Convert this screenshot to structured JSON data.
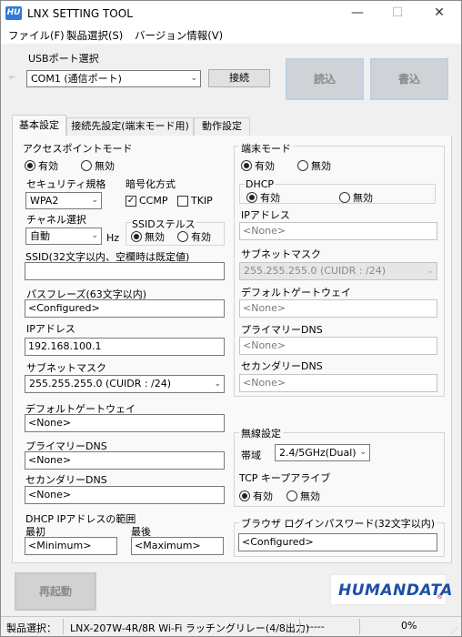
{
  "window": {
    "title": "LNX SETTING TOOL",
    "minimize": "—",
    "maximize": "☐",
    "close": "✕",
    "app_icon_text": "HU"
  },
  "menu": [
    "ファイル(F)",
    "製品選択(S)",
    "バージョン情報(V)"
  ],
  "usb": {
    "label": "USBポート選択",
    "port_value": "COM1 (通信ポート)",
    "connect_button": "接続"
  },
  "actions": {
    "read_button": "読込",
    "write_button": "書込",
    "restart_button": "再起動"
  },
  "tabs": [
    "基本設定",
    "接続先設定(端末モード用)",
    "動作設定"
  ],
  "access_point": {
    "group_label": "アクセスポイントモード",
    "enable": "有効",
    "disable": "無効",
    "selected": "enable",
    "security_label": "セキュリティ規格",
    "security_value": "WPA2",
    "encryption_label": "暗号化方式",
    "ccmp_label": "CCMP",
    "ccmp_checked": true,
    "tkip_label": "TKIP",
    "tkip_checked": false,
    "channel_label": "チャネル選択",
    "channel_value": "自動",
    "channel_unit": "Hz",
    "stealth_label": "SSIDステルス",
    "stealth_disable": "無効",
    "stealth_enable": "有効",
    "stealth_selected": "disable",
    "ssid_label": "SSID(32文字以内、空欄時は既定値)",
    "ssid_value": "",
    "passphrase_label": "パスフレーズ(63文字以内)",
    "passphrase_value": "<Configured>",
    "ip_label": "IPアドレス",
    "ip_value": "192.168.100.1",
    "subnet_label": "サブネットマスク",
    "subnet_value": "255.255.255.0 (CUIDR : /24)",
    "gateway_label": "デフォルトゲートウェイ",
    "gateway_value": "<None>",
    "dns1_label": "プライマリーDNS",
    "dns1_value": "<None>",
    "dns2_label": "セカンダリーDNS",
    "dns2_value": "<None>",
    "dhcp_range_label": "DHCP IPアドレスの範囲",
    "range_first_label": "最初",
    "range_first_value": "<Minimum>",
    "range_last_label": "最後",
    "range_last_value": "<Maximum>"
  },
  "terminal": {
    "group_label": "端末モード",
    "enable": "有効",
    "disable": "無効",
    "selected": "enable",
    "dhcp_label": "DHCP",
    "dhcp_enable": "有効",
    "dhcp_disable": "無効",
    "dhcp_selected": "enable",
    "ip_label": "IPアドレス",
    "ip_value": "<None>",
    "subnet_label": "サブネットマスク",
    "subnet_value": "255.255.255.0 (CUIDR : /24)",
    "gateway_label": "デフォルトゲートウェイ",
    "gateway_value": "<None>",
    "dns1_label": "プライマリーDNS",
    "dns1_value": "<None>",
    "dns2_label": "セカンダリーDNS",
    "dns2_value": "<None>"
  },
  "wireless": {
    "group_label": "無線設定",
    "band_label": "帯域",
    "band_value": "2.4/5GHz(Dual)",
    "keepalive_label": "TCP キープアライブ",
    "keepalive_enable": "有効",
    "keepalive_disable": "無効",
    "keepalive_selected": "enable"
  },
  "browser": {
    "label": "ブラウザ ログインパスワード(32文字以内)",
    "value": "<Configured>"
  },
  "logo_text": "HUMANDATA",
  "logo_mark": "®",
  "status": {
    "product_label": "製品選択：",
    "product_value": "LNX-207W-4R/8R Wi-Fi ラッチングリレー(4/8出力)",
    "middle": "-----",
    "progress": "0%"
  }
}
